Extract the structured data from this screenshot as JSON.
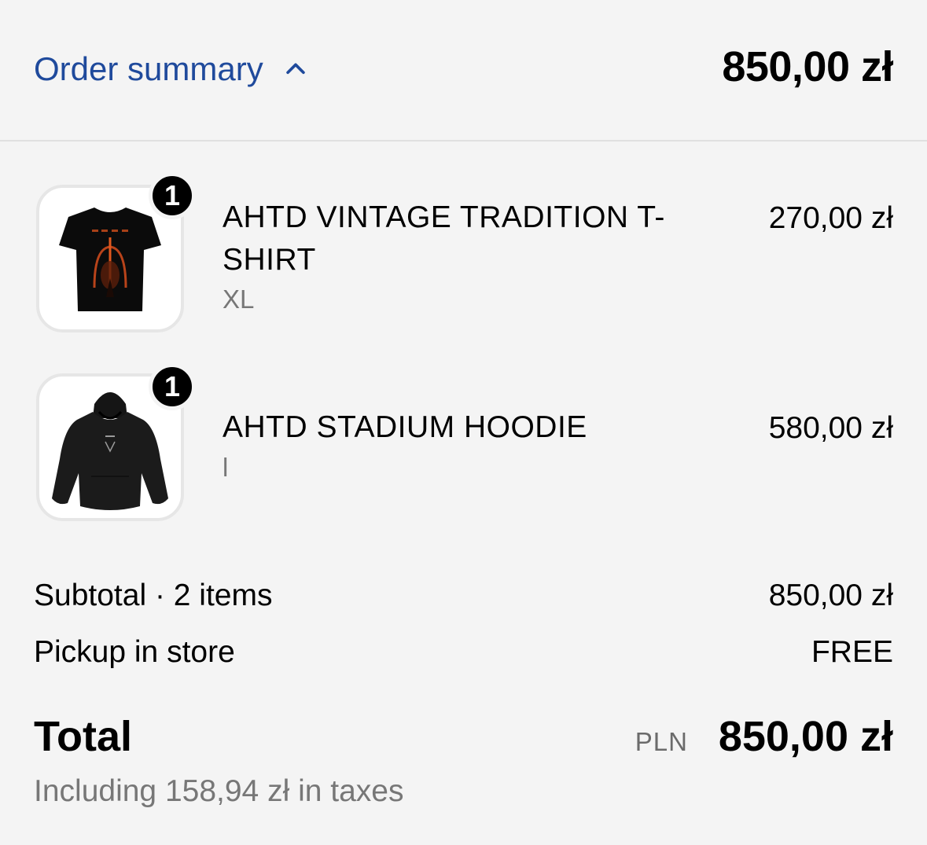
{
  "header": {
    "summary_label": "Order summary",
    "toggle_icon": "chevron-up-icon",
    "total": "850,00 zł",
    "accent_color": "#1f4a9c"
  },
  "items": [
    {
      "quantity": "1",
      "name": "AHTD VINTAGE TRADITION T-SHIRT",
      "variant": "XL",
      "price": "270,00 zł",
      "image": "black-tshirt-image"
    },
    {
      "quantity": "1",
      "name": "AHTD STADIUM HOODIE",
      "variant": "l",
      "price": "580,00 zł",
      "image": "black-hoodie-image"
    }
  ],
  "subtotal": {
    "label": "Subtotal · 2 items",
    "value": "850,00 zł"
  },
  "shipping": {
    "label": "Pickup in store",
    "value": "FREE"
  },
  "total": {
    "label": "Total",
    "currency": "PLN",
    "value": "850,00 zł",
    "taxes_note": "Including 158,94 zł in taxes"
  }
}
